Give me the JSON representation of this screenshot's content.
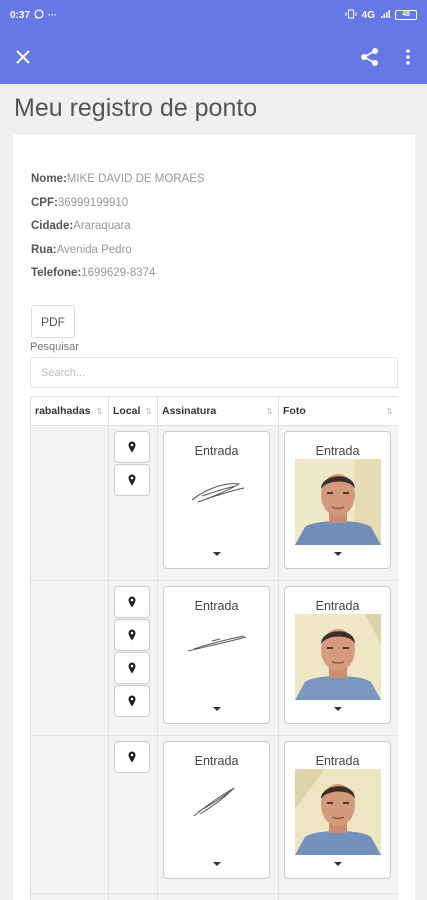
{
  "status_bar": {
    "time": "0:37",
    "network": "4G",
    "battery": "48",
    "icons": [
      "whatsapp-icon",
      "more-dots-icon",
      "vibrate-icon",
      "signal-icon",
      "battery-icon"
    ]
  },
  "app_bar": {
    "icons": [
      "close-icon",
      "share-icon",
      "more-vert-icon"
    ],
    "color": "#6677e6"
  },
  "page": {
    "title": "Meu registro de ponto"
  },
  "info": {
    "nome_label": "Nome:",
    "nome_value": "MIKE DAVID DE MORAES",
    "cpf_label": "CPF:",
    "cpf_value": "36999199910",
    "cidade_label": "Cidade:",
    "cidade_value": "Araraquara",
    "rua_label": "Rua:",
    "rua_value": "Avenida Pedro",
    "telefone_label": "Telefone:",
    "telefone_value": "1699629-8374"
  },
  "pdf_button": "PDF",
  "search": {
    "label": "Pesquisar",
    "placeholder": "Search..."
  },
  "table": {
    "columns": [
      "rabalhadas",
      "Local",
      "Assinatura",
      "Foto"
    ],
    "sort_glyph": "⇅",
    "rows": [
      {
        "pins": 2,
        "assinatura": "Entrada",
        "foto": "Entrada"
      },
      {
        "pins": 4,
        "assinatura": "Entrada",
        "foto": "Entrada"
      },
      {
        "pins": 1,
        "assinatura": "Entrada",
        "foto": "Entrada"
      }
    ]
  }
}
